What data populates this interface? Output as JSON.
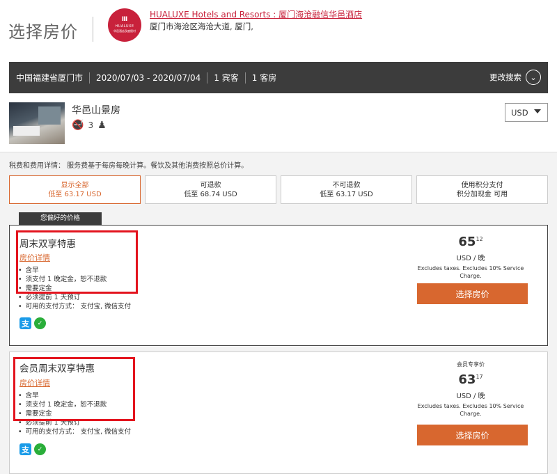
{
  "header": {
    "page_title": "选择房价",
    "hotel_name": "HUALUXE Hotels and Resorts : 厦门海沧融信华邑酒店",
    "hotel_address": "厦门市海沧区海沧大道, 厦门,",
    "logo": {
      "mark": "Ⅲ",
      "text": "HUALUXE",
      "sub": "华邑酒店及度假村"
    }
  },
  "search": {
    "location": "中国福建省厦门市",
    "dates": "2020/07/03 - 2020/07/04",
    "guests": "1 宾客",
    "rooms": "1 客房",
    "modify_label": "更改搜索"
  },
  "room": {
    "name": "华邑山景房",
    "occupancy": "3",
    "currency": "USD"
  },
  "tax_note": "税费和费用详情： 服务费基于每房每晚计算。餐饮及其他消费按照总价计算。",
  "filters": [
    {
      "label": "显示全部",
      "sub": "低至 63.17 USD"
    },
    {
      "label": "可退款",
      "sub": "低至 68.74 USD"
    },
    {
      "label": "不可退款",
      "sub": "低至 63.17 USD"
    },
    {
      "label": "使用积分支付",
      "sub": "积分加现金 可用"
    }
  ],
  "preferred_label": "您偏好的价格",
  "rates": [
    {
      "title": "周末双享特惠",
      "detail": "房价详情",
      "items": [
        "含早",
        "须支付 1 晚定金，恕不退款",
        "需要定金",
        "必须提前 1 天预订",
        "可用的支付方式： 支付宝, 微信支付"
      ],
      "member_tag": "",
      "price_main": "65",
      "price_cents": "12",
      "unit": "USD / 晚",
      "note": "Excludes taxes. Excludes 10% Service Charge.",
      "button": "选择房价"
    },
    {
      "title": "会员周末双享特惠",
      "detail": "房价详情",
      "items": [
        "含早",
        "须支付 1 晚定金，恕不退款",
        "需要定金",
        "必须提前 1 天预订",
        "可用的支付方式： 支付宝, 微信支付"
      ],
      "member_tag": "会员专享价",
      "price_main": "63",
      "price_cents": "17",
      "unit": "USD / 晚",
      "note": "Excludes taxes. Excludes 10% Service Charge.",
      "button": "选择房价"
    }
  ],
  "colors": {
    "brand": "#c8213b",
    "accent": "#d8672f",
    "bar": "#3c3c3c",
    "highlight": "#e3141e"
  },
  "icons": {
    "alipay": "alipay-icon",
    "wechat": "wechat-pay-icon",
    "no_smoking": "no-smoking-icon",
    "guest": "guest-icon"
  }
}
